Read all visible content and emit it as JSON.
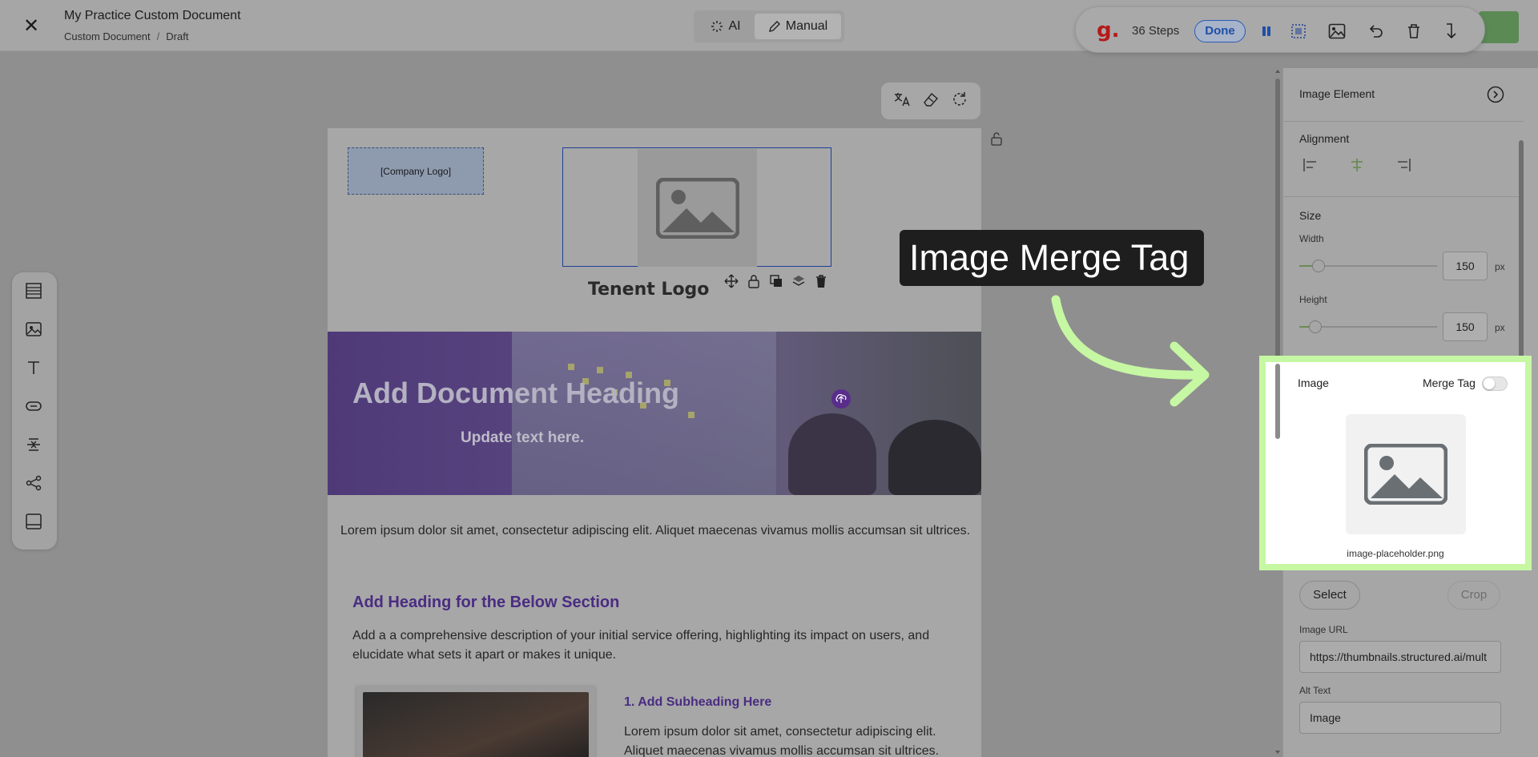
{
  "topbar": {
    "title": "My Practice Custom Document",
    "breadcrumb": [
      "Custom Document",
      "Draft"
    ],
    "modes": {
      "ai": "AI",
      "manual": "Manual"
    }
  },
  "recorder": {
    "logo": "g.",
    "steps": "36 Steps",
    "done": "Done"
  },
  "document": {
    "company_logo": "[Company Logo]",
    "tenant_logo": "Tenent Logo",
    "hero_heading": "Add Document Heading",
    "hero_sub": "Update text here.",
    "paragraph1": "Lorem ipsum dolor sit amet, consectetur adipiscing elit. Aliquet maecenas vivamus mollis accumsan sit ultrices.",
    "section_heading": "Add Heading for the Below Section",
    "section_paragraph": "Add a a comprehensive description of your initial service offering, highlighting its impact on users, and elucidate what sets it apart or makes it unique.",
    "subheading": "1. Add Subheading Here",
    "sub_paragraph": "Lorem ipsum dolor sit amet, consectetur adipiscing elit. Aliquet maecenas vivamus mollis accumsan sit ultrices."
  },
  "callout": "Image Merge Tag",
  "panel": {
    "title": "Image Element",
    "alignment_label": "Alignment",
    "size_label": "Size",
    "width_label": "Width",
    "width_value": "150",
    "height_label": "Height",
    "height_value": "150",
    "unit": "px",
    "image_label": "Image",
    "merge_tag_label": "Merge Tag",
    "merge_tag_on": false,
    "file_name": "image-placeholder.png",
    "select_button": "Select",
    "crop_button": "Crop",
    "image_url_label": "Image URL",
    "image_url_value": "https://thumbnails.structured.ai/mult",
    "alt_text_label": "Alt Text",
    "alt_text_value": "Image"
  },
  "colors": {
    "highlight": "#c6f7a3",
    "accent_purple": "#4a2c82",
    "brand_red": "#b51a1a"
  }
}
